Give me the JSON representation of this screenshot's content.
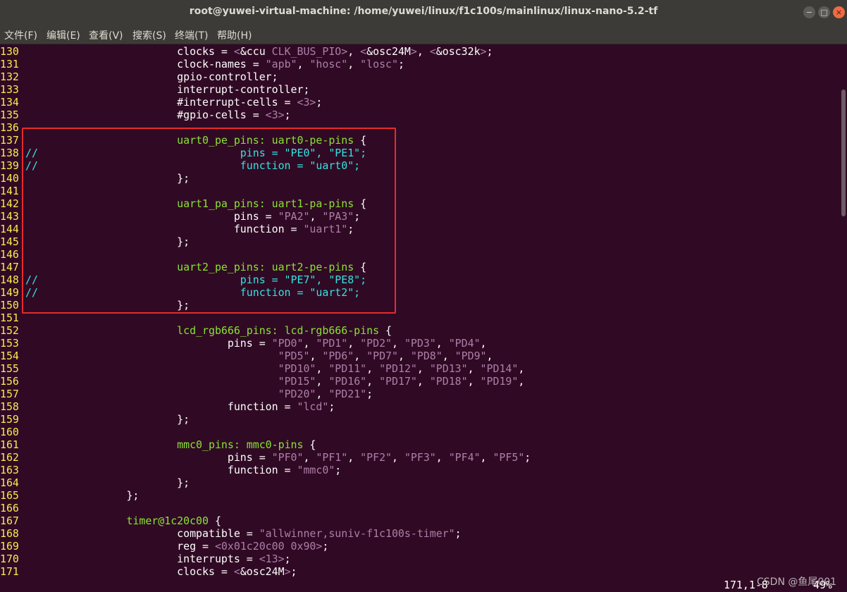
{
  "window": {
    "title": "root@yuwei-virtual-machine: /home/yuwei/linux/f1c100s/mainlinux/linux-nano-5.2-tf",
    "minimize_glyph": "−",
    "maximize_glyph": "□",
    "close_glyph": "×"
  },
  "menu": [
    "文件(F)",
    "编辑(E)",
    "查看(V)",
    "搜索(S)",
    "终端(T)",
    "帮助(H)"
  ],
  "colors": {
    "background": "#300a24",
    "line_number": "#fce94f",
    "comment": "#34e2e2",
    "label": "#8ae234",
    "string": "#ad7fa8",
    "highlight_box": "#e62b2b"
  },
  "lines": [
    {
      "n": "130",
      "segs": [
        {
          "t": "\t\t\tclocks = ",
          "c": ""
        },
        {
          "t": "<",
          "c": "st"
        },
        {
          "t": "&ccu",
          "c": ""
        },
        {
          "t": " CLK_BUS_PIO>",
          "c": "st"
        },
        {
          "t": ", ",
          "c": ""
        },
        {
          "t": "<",
          "c": "st"
        },
        {
          "t": "&osc24M",
          "c": ""
        },
        {
          "t": ">",
          "c": "st"
        },
        {
          "t": ", ",
          "c": ""
        },
        {
          "t": "<",
          "c": "st"
        },
        {
          "t": "&osc32k",
          "c": ""
        },
        {
          "t": ">",
          "c": "st"
        },
        {
          "t": ";",
          "c": ""
        }
      ]
    },
    {
      "n": "131",
      "segs": [
        {
          "t": "\t\t\tclock-names = ",
          "c": ""
        },
        {
          "t": "\"apb\"",
          "c": "st"
        },
        {
          "t": ", ",
          "c": ""
        },
        {
          "t": "\"hosc\"",
          "c": "st"
        },
        {
          "t": ", ",
          "c": ""
        },
        {
          "t": "\"losc\"",
          "c": "st"
        },
        {
          "t": ";",
          "c": ""
        }
      ]
    },
    {
      "n": "132",
      "segs": [
        {
          "t": "\t\t\tgpio-controller;",
          "c": ""
        }
      ]
    },
    {
      "n": "133",
      "segs": [
        {
          "t": "\t\t\tinterrupt-controller;",
          "c": ""
        }
      ]
    },
    {
      "n": "134",
      "segs": [
        {
          "t": "\t\t\t#interrupt-cells = ",
          "c": ""
        },
        {
          "t": "<3>",
          "c": "st"
        },
        {
          "t": ";",
          "c": ""
        }
      ]
    },
    {
      "n": "135",
      "segs": [
        {
          "t": "\t\t\t#gpio-cells = ",
          "c": ""
        },
        {
          "t": "<3>",
          "c": "st"
        },
        {
          "t": ";",
          "c": ""
        }
      ]
    },
    {
      "n": "136",
      "segs": []
    },
    {
      "n": "137",
      "segs": [
        {
          "t": "\t\t\tuart0_pe_pins: ",
          "c": "kw"
        },
        {
          "t": "uart0-pe-pins",
          "c": "kw"
        },
        {
          "t": " {",
          "c": ""
        }
      ]
    },
    {
      "n": "138",
      "segs": [
        {
          "t": "//\t\t\t\tpins = \"PE0\", \"PE1\";",
          "c": "cm"
        }
      ]
    },
    {
      "n": "139",
      "segs": [
        {
          "t": "//\t\t\t\tfunction = \"uart0\";",
          "c": "cm"
        }
      ]
    },
    {
      "n": "140",
      "segs": [
        {
          "t": "\t\t\t};",
          "c": ""
        }
      ]
    },
    {
      "n": "141",
      "segs": []
    },
    {
      "n": "142",
      "segs": [
        {
          "t": "\t\t\tuart1_pa_pins: ",
          "c": "kw"
        },
        {
          "t": "uart1-pa-pins",
          "c": "kw"
        },
        {
          "t": " {",
          "c": ""
        }
      ]
    },
    {
      "n": "143",
      "segs": [
        {
          "t": "\t\t\t\t pins = ",
          "c": ""
        },
        {
          "t": "\"PA2\"",
          "c": "st"
        },
        {
          "t": ", ",
          "c": ""
        },
        {
          "t": "\"PA3\"",
          "c": "st"
        },
        {
          "t": ";",
          "c": ""
        }
      ]
    },
    {
      "n": "144",
      "segs": [
        {
          "t": "\t\t\t\t function = ",
          "c": ""
        },
        {
          "t": "\"uart1\"",
          "c": "st"
        },
        {
          "t": ";",
          "c": ""
        }
      ]
    },
    {
      "n": "145",
      "segs": [
        {
          "t": "\t\t\t};",
          "c": ""
        }
      ]
    },
    {
      "n": "146",
      "segs": []
    },
    {
      "n": "147",
      "segs": [
        {
          "t": "\t\t\tuart2_pe_pins: ",
          "c": "kw"
        },
        {
          "t": "uart2-pe-pins",
          "c": "kw"
        },
        {
          "t": " {",
          "c": ""
        }
      ]
    },
    {
      "n": "148",
      "segs": [
        {
          "t": "//\t\t\t\tpins = \"PE7\", \"PE8\";",
          "c": "cm"
        }
      ]
    },
    {
      "n": "149",
      "segs": [
        {
          "t": "//\t\t\t\tfunction = \"uart2\";",
          "c": "cm"
        }
      ]
    },
    {
      "n": "150",
      "segs": [
        {
          "t": "\t\t\t};",
          "c": ""
        }
      ]
    },
    {
      "n": "151",
      "segs": []
    },
    {
      "n": "152",
      "segs": [
        {
          "t": "\t\t\tlcd_rgb666_pins: ",
          "c": "kw"
        },
        {
          "t": "lcd-rgb666-pins",
          "c": "kw"
        },
        {
          "t": " {",
          "c": ""
        }
      ]
    },
    {
      "n": "153",
      "segs": [
        {
          "t": "\t\t\t\tpins = ",
          "c": ""
        },
        {
          "t": "\"PD0\"",
          "c": "st"
        },
        {
          "t": ", ",
          "c": ""
        },
        {
          "t": "\"PD1\"",
          "c": "st"
        },
        {
          "t": ", ",
          "c": ""
        },
        {
          "t": "\"PD2\"",
          "c": "st"
        },
        {
          "t": ", ",
          "c": ""
        },
        {
          "t": "\"PD3\"",
          "c": "st"
        },
        {
          "t": ", ",
          "c": ""
        },
        {
          "t": "\"PD4\"",
          "c": "st"
        },
        {
          "t": ",",
          "c": ""
        }
      ]
    },
    {
      "n": "154",
      "segs": [
        {
          "t": "\t\t\t\t\t",
          "c": ""
        },
        {
          "t": "\"PD5\"",
          "c": "st"
        },
        {
          "t": ", ",
          "c": ""
        },
        {
          "t": "\"PD6\"",
          "c": "st"
        },
        {
          "t": ", ",
          "c": ""
        },
        {
          "t": "\"PD7\"",
          "c": "st"
        },
        {
          "t": ", ",
          "c": ""
        },
        {
          "t": "\"PD8\"",
          "c": "st"
        },
        {
          "t": ", ",
          "c": ""
        },
        {
          "t": "\"PD9\"",
          "c": "st"
        },
        {
          "t": ",",
          "c": ""
        }
      ]
    },
    {
      "n": "155",
      "segs": [
        {
          "t": "\t\t\t\t\t",
          "c": ""
        },
        {
          "t": "\"PD10\"",
          "c": "st"
        },
        {
          "t": ", ",
          "c": ""
        },
        {
          "t": "\"PD11\"",
          "c": "st"
        },
        {
          "t": ", ",
          "c": ""
        },
        {
          "t": "\"PD12\"",
          "c": "st"
        },
        {
          "t": ", ",
          "c": ""
        },
        {
          "t": "\"PD13\"",
          "c": "st"
        },
        {
          "t": ", ",
          "c": ""
        },
        {
          "t": "\"PD14\"",
          "c": "st"
        },
        {
          "t": ",",
          "c": ""
        }
      ]
    },
    {
      "n": "156",
      "segs": [
        {
          "t": "\t\t\t\t\t",
          "c": ""
        },
        {
          "t": "\"PD15\"",
          "c": "st"
        },
        {
          "t": ", ",
          "c": ""
        },
        {
          "t": "\"PD16\"",
          "c": "st"
        },
        {
          "t": ", ",
          "c": ""
        },
        {
          "t": "\"PD17\"",
          "c": "st"
        },
        {
          "t": ", ",
          "c": ""
        },
        {
          "t": "\"PD18\"",
          "c": "st"
        },
        {
          "t": ", ",
          "c": ""
        },
        {
          "t": "\"PD19\"",
          "c": "st"
        },
        {
          "t": ",",
          "c": ""
        }
      ]
    },
    {
      "n": "157",
      "segs": [
        {
          "t": "\t\t\t\t\t",
          "c": ""
        },
        {
          "t": "\"PD20\"",
          "c": "st"
        },
        {
          "t": ", ",
          "c": ""
        },
        {
          "t": "\"PD21\"",
          "c": "st"
        },
        {
          "t": ";",
          "c": ""
        }
      ]
    },
    {
      "n": "158",
      "segs": [
        {
          "t": "\t\t\t\tfunction = ",
          "c": ""
        },
        {
          "t": "\"lcd\"",
          "c": "st"
        },
        {
          "t": ";",
          "c": ""
        }
      ]
    },
    {
      "n": "159",
      "segs": [
        {
          "t": "\t\t\t};",
          "c": ""
        }
      ]
    },
    {
      "n": "160",
      "segs": []
    },
    {
      "n": "161",
      "segs": [
        {
          "t": "\t\t\tmmc0_pins: ",
          "c": "kw"
        },
        {
          "t": "mmc0-pins",
          "c": "kw"
        },
        {
          "t": " {",
          "c": ""
        }
      ]
    },
    {
      "n": "162",
      "segs": [
        {
          "t": "\t\t\t\tpins = ",
          "c": ""
        },
        {
          "t": "\"PF0\"",
          "c": "st"
        },
        {
          "t": ", ",
          "c": ""
        },
        {
          "t": "\"PF1\"",
          "c": "st"
        },
        {
          "t": ", ",
          "c": ""
        },
        {
          "t": "\"PF2\"",
          "c": "st"
        },
        {
          "t": ", ",
          "c": ""
        },
        {
          "t": "\"PF3\"",
          "c": "st"
        },
        {
          "t": ", ",
          "c": ""
        },
        {
          "t": "\"PF4\"",
          "c": "st"
        },
        {
          "t": ", ",
          "c": ""
        },
        {
          "t": "\"PF5\"",
          "c": "st"
        },
        {
          "t": ";",
          "c": ""
        }
      ]
    },
    {
      "n": "163",
      "segs": [
        {
          "t": "\t\t\t\tfunction = ",
          "c": ""
        },
        {
          "t": "\"mmc0\"",
          "c": "st"
        },
        {
          "t": ";",
          "c": ""
        }
      ]
    },
    {
      "n": "164",
      "segs": [
        {
          "t": "\t\t\t};",
          "c": ""
        }
      ]
    },
    {
      "n": "165",
      "segs": [
        {
          "t": "\t\t};",
          "c": ""
        }
      ]
    },
    {
      "n": "166",
      "segs": []
    },
    {
      "n": "167",
      "segs": [
        {
          "t": "\t\ttimer@1c20c00",
          "c": "kw"
        },
        {
          "t": " {",
          "c": ""
        }
      ]
    },
    {
      "n": "168",
      "segs": [
        {
          "t": "\t\t\tcompatible = ",
          "c": ""
        },
        {
          "t": "\"allwinner,suniv-f1c100s-timer\"",
          "c": "st"
        },
        {
          "t": ";",
          "c": ""
        }
      ]
    },
    {
      "n": "169",
      "segs": [
        {
          "t": "\t\t\treg = ",
          "c": ""
        },
        {
          "t": "<0x01c20c00 0x90>",
          "c": "st"
        },
        {
          "t": ";",
          "c": ""
        }
      ]
    },
    {
      "n": "170",
      "segs": [
        {
          "t": "\t\t\tinterrupts = ",
          "c": ""
        },
        {
          "t": "<13>",
          "c": "st"
        },
        {
          "t": ";",
          "c": ""
        }
      ]
    },
    {
      "n": "171",
      "segs": [
        {
          "t": "\t\t\tclocks = ",
          "c": ""
        },
        {
          "t": "<",
          "c": "st"
        },
        {
          "t": "&osc24M",
          "c": ""
        },
        {
          "t": ">",
          "c": "st"
        },
        {
          "t": ";",
          "c": ""
        }
      ]
    }
  ],
  "status": {
    "position": "171,1-8",
    "percent": "49%"
  },
  "watermark": "CSDN @鱼尾001"
}
